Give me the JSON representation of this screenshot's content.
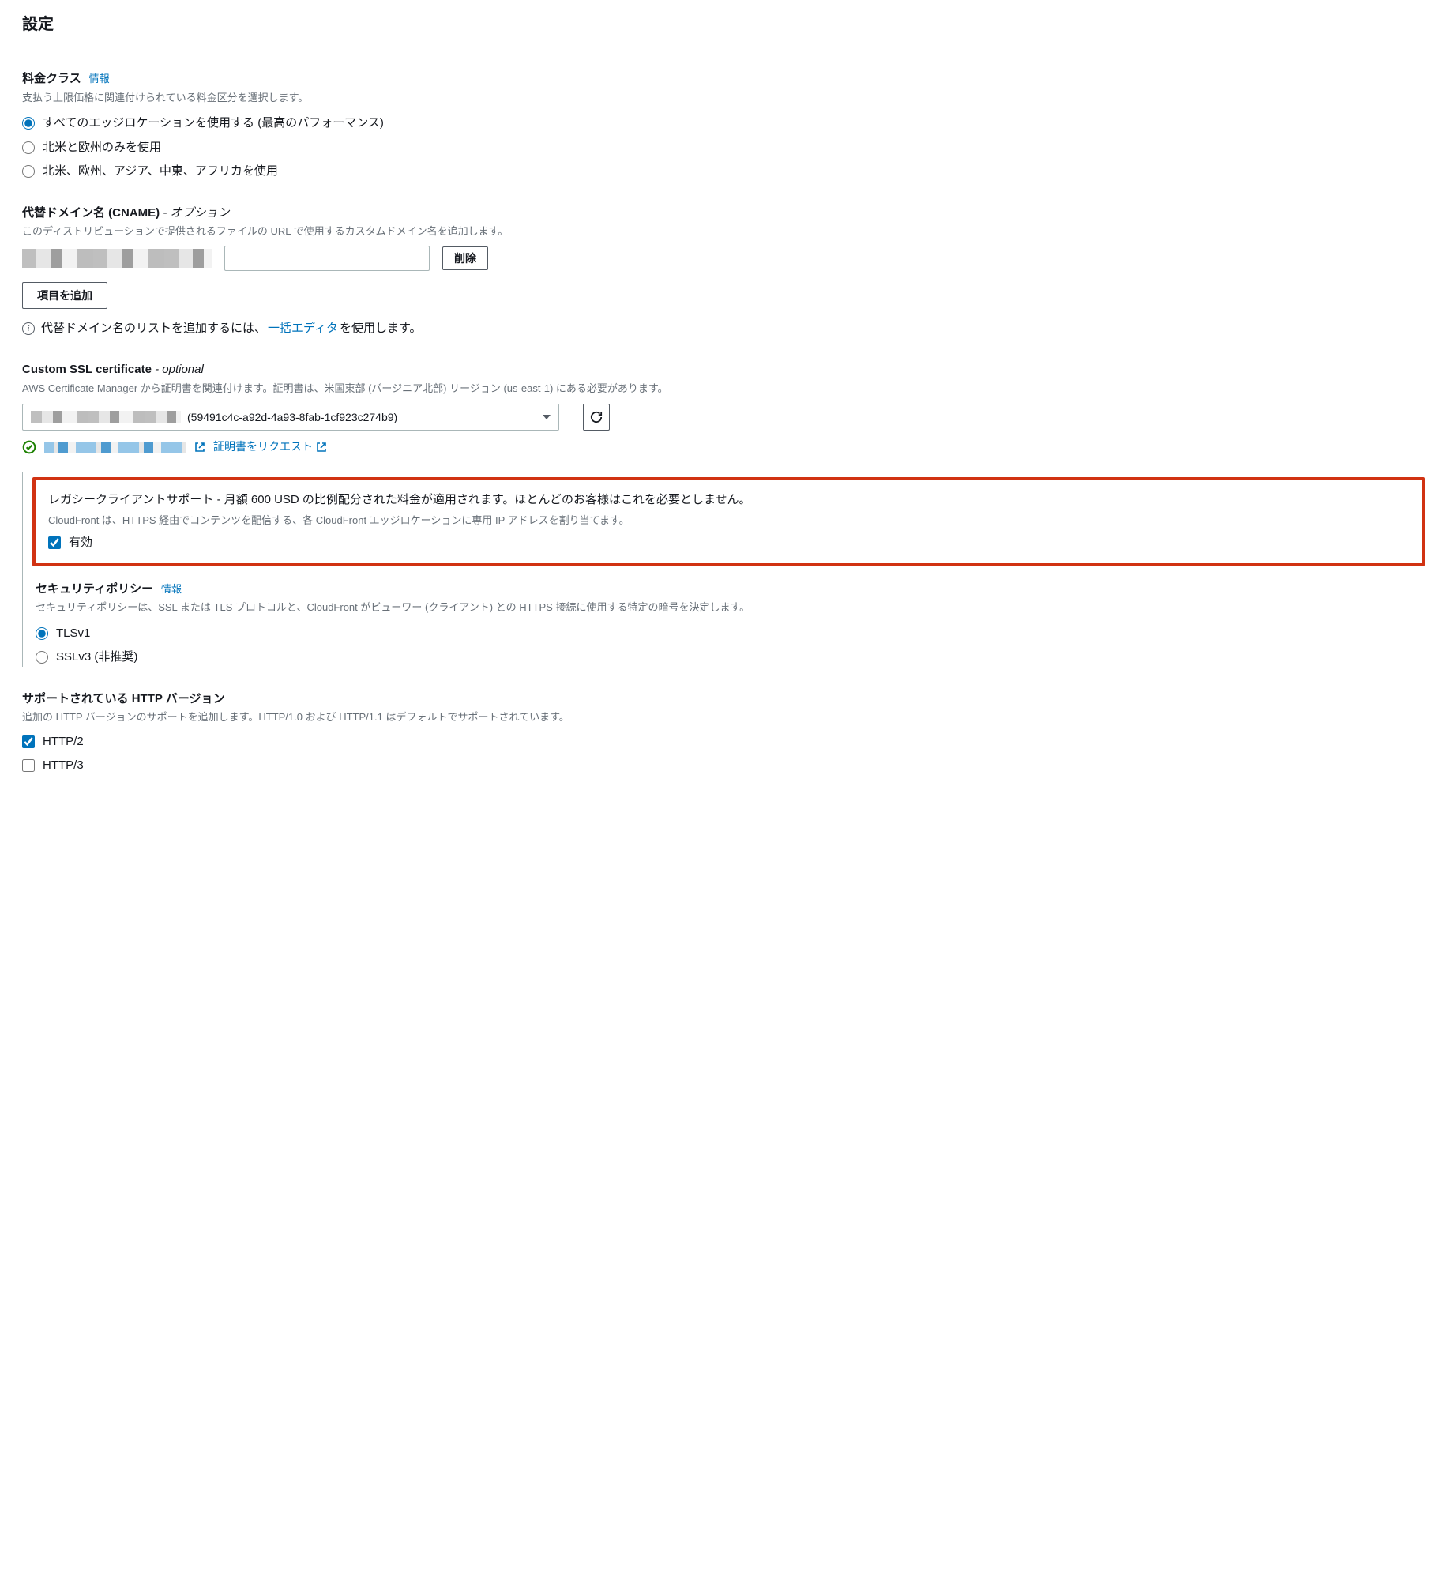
{
  "page_title": "設定",
  "price_class": {
    "title": "料金クラス",
    "info_label": "情報",
    "desc": "支払う上限価格に関連付けられている料金区分を選択します。",
    "options": [
      "すべてのエッジロケーションを使用する (最高のパフォーマンス)",
      "北米と欧州のみを使用",
      "北米、欧州、アジア、中東、アフリカを使用"
    ]
  },
  "cname": {
    "title": "代替ドメイン名 (CNAME)",
    "optional": " - オプション",
    "desc": "このディストリビューションで提供されるファイルの URL で使用するカスタムドメイン名を追加します。",
    "delete_label": "削除",
    "add_label": "項目を追加",
    "bulk_prefix": "代替ドメイン名のリストを追加するには、",
    "bulk_link": "一括エディタ",
    "bulk_suffix": " を使用します。"
  },
  "ssl": {
    "title": "Custom SSL certificate",
    "optional_suffix": " - optional",
    "desc": "AWS Certificate Manager から証明書を関連付けます。証明書は、米国東部 (バージニア北部) リージョン (us-east-1) にある必要があります。",
    "selected": "(59491c4c-a92d-4a93-8fab-1cf923c274b9)",
    "request_cert": "証明書をリクエスト"
  },
  "legacy": {
    "title": "レガシークライアントサポート - 月額 600 USD の比例配分された料金が適用されます。ほとんどのお客様はこれを必要としません。",
    "desc": "CloudFront は、HTTPS 経由でコンテンツを配信する、各 CloudFront エッジロケーションに専用 IP アドレスを割り当てます。",
    "enabled_label": "有効"
  },
  "security_policy": {
    "title": "セキュリティポリシー",
    "info_label": "情報",
    "desc": "セキュリティポリシーは、SSL または TLS プロトコルと、CloudFront がビューワー (クライアント) との HTTPS 接続に使用する特定の暗号を決定します。",
    "options": [
      "TLSv1",
      "SSLv3 (非推奨)"
    ]
  },
  "http_versions": {
    "title": "サポートされている HTTP バージョン",
    "desc": "追加の HTTP バージョンのサポートを追加します。HTTP/1.0 および HTTP/1.1 はデフォルトでサポートされています。",
    "options": [
      "HTTP/2",
      "HTTP/3"
    ]
  }
}
